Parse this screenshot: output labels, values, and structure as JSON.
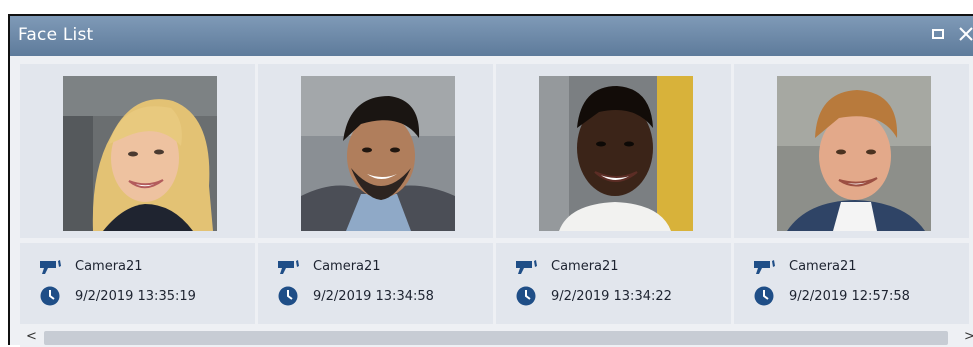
{
  "window": {
    "title": "Face List",
    "accent": "#6b86a6"
  },
  "faces": [
    {
      "camera": "Camera21",
      "time": "9/2/2019 13:35:19",
      "photo_icon": "face-photo"
    },
    {
      "camera": "Camera21",
      "time": "9/2/2019 13:34:58",
      "photo_icon": "face-photo"
    },
    {
      "camera": "Camera21",
      "time": "9/2/2019 13:34:22",
      "photo_icon": "face-photo"
    },
    {
      "camera": "Camera21",
      "time": "9/2/2019 12:57:58",
      "photo_icon": "face-photo"
    }
  ],
  "scrollbar": {
    "left_arrow": "<",
    "right_arrow": ">"
  }
}
